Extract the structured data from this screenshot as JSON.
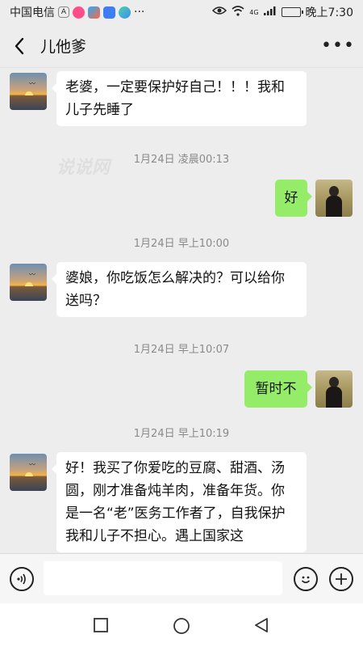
{
  "status_bar": {
    "carrier": "中国电信",
    "dots": "···",
    "network": "4G",
    "time": "晚上7:30",
    "battery_level": 0.35
  },
  "header": {
    "title": "儿他爹",
    "back_icon": "chevron-left-icon",
    "more_icon": "more-icon",
    "more_glyph": "•••"
  },
  "watermark": "说说网",
  "messages": [
    {
      "side": "left",
      "avatar": "sunset-avatar",
      "text": "老婆，一定要保护好自己！！！我和儿子先睡了"
    },
    {
      "type": "timestamp",
      "text": "1月24日 凌晨00:13"
    },
    {
      "side": "right",
      "avatar": "woman-avatar",
      "text": "好"
    },
    {
      "type": "timestamp",
      "text": "1月24日 早上10:00"
    },
    {
      "side": "left",
      "avatar": "sunset-avatar",
      "text": "婆娘，你吃饭怎么解决的？可以给你送吗？"
    },
    {
      "type": "timestamp",
      "text": "1月24日 早上10:07"
    },
    {
      "side": "right",
      "avatar": "woman-avatar",
      "text": "暂时不"
    },
    {
      "type": "timestamp",
      "text": "1月24日 早上10:19"
    },
    {
      "side": "left",
      "avatar": "sunset-avatar",
      "text": "好！我买了你爱吃的豆腐、甜酒、汤圆，刚才准备炖羊肉，准备年货。你是一名“老”医务工作者了，自我保护我和儿子不担心。遇上国家这"
    }
  ],
  "input_bar": {
    "voice_icon": "voice-icon",
    "emoji_icon": "emoji-icon",
    "plus_icon": "plus-icon",
    "input_value": ""
  },
  "system_nav": {
    "recent_icon": "square-icon",
    "home_icon": "circle-icon",
    "back_icon": "triangle-back-icon"
  },
  "colors": {
    "background": "#ededed",
    "bubble_self": "#95ec69",
    "bubble_other": "#ffffff",
    "timestamp": "#8a8a8a"
  }
}
